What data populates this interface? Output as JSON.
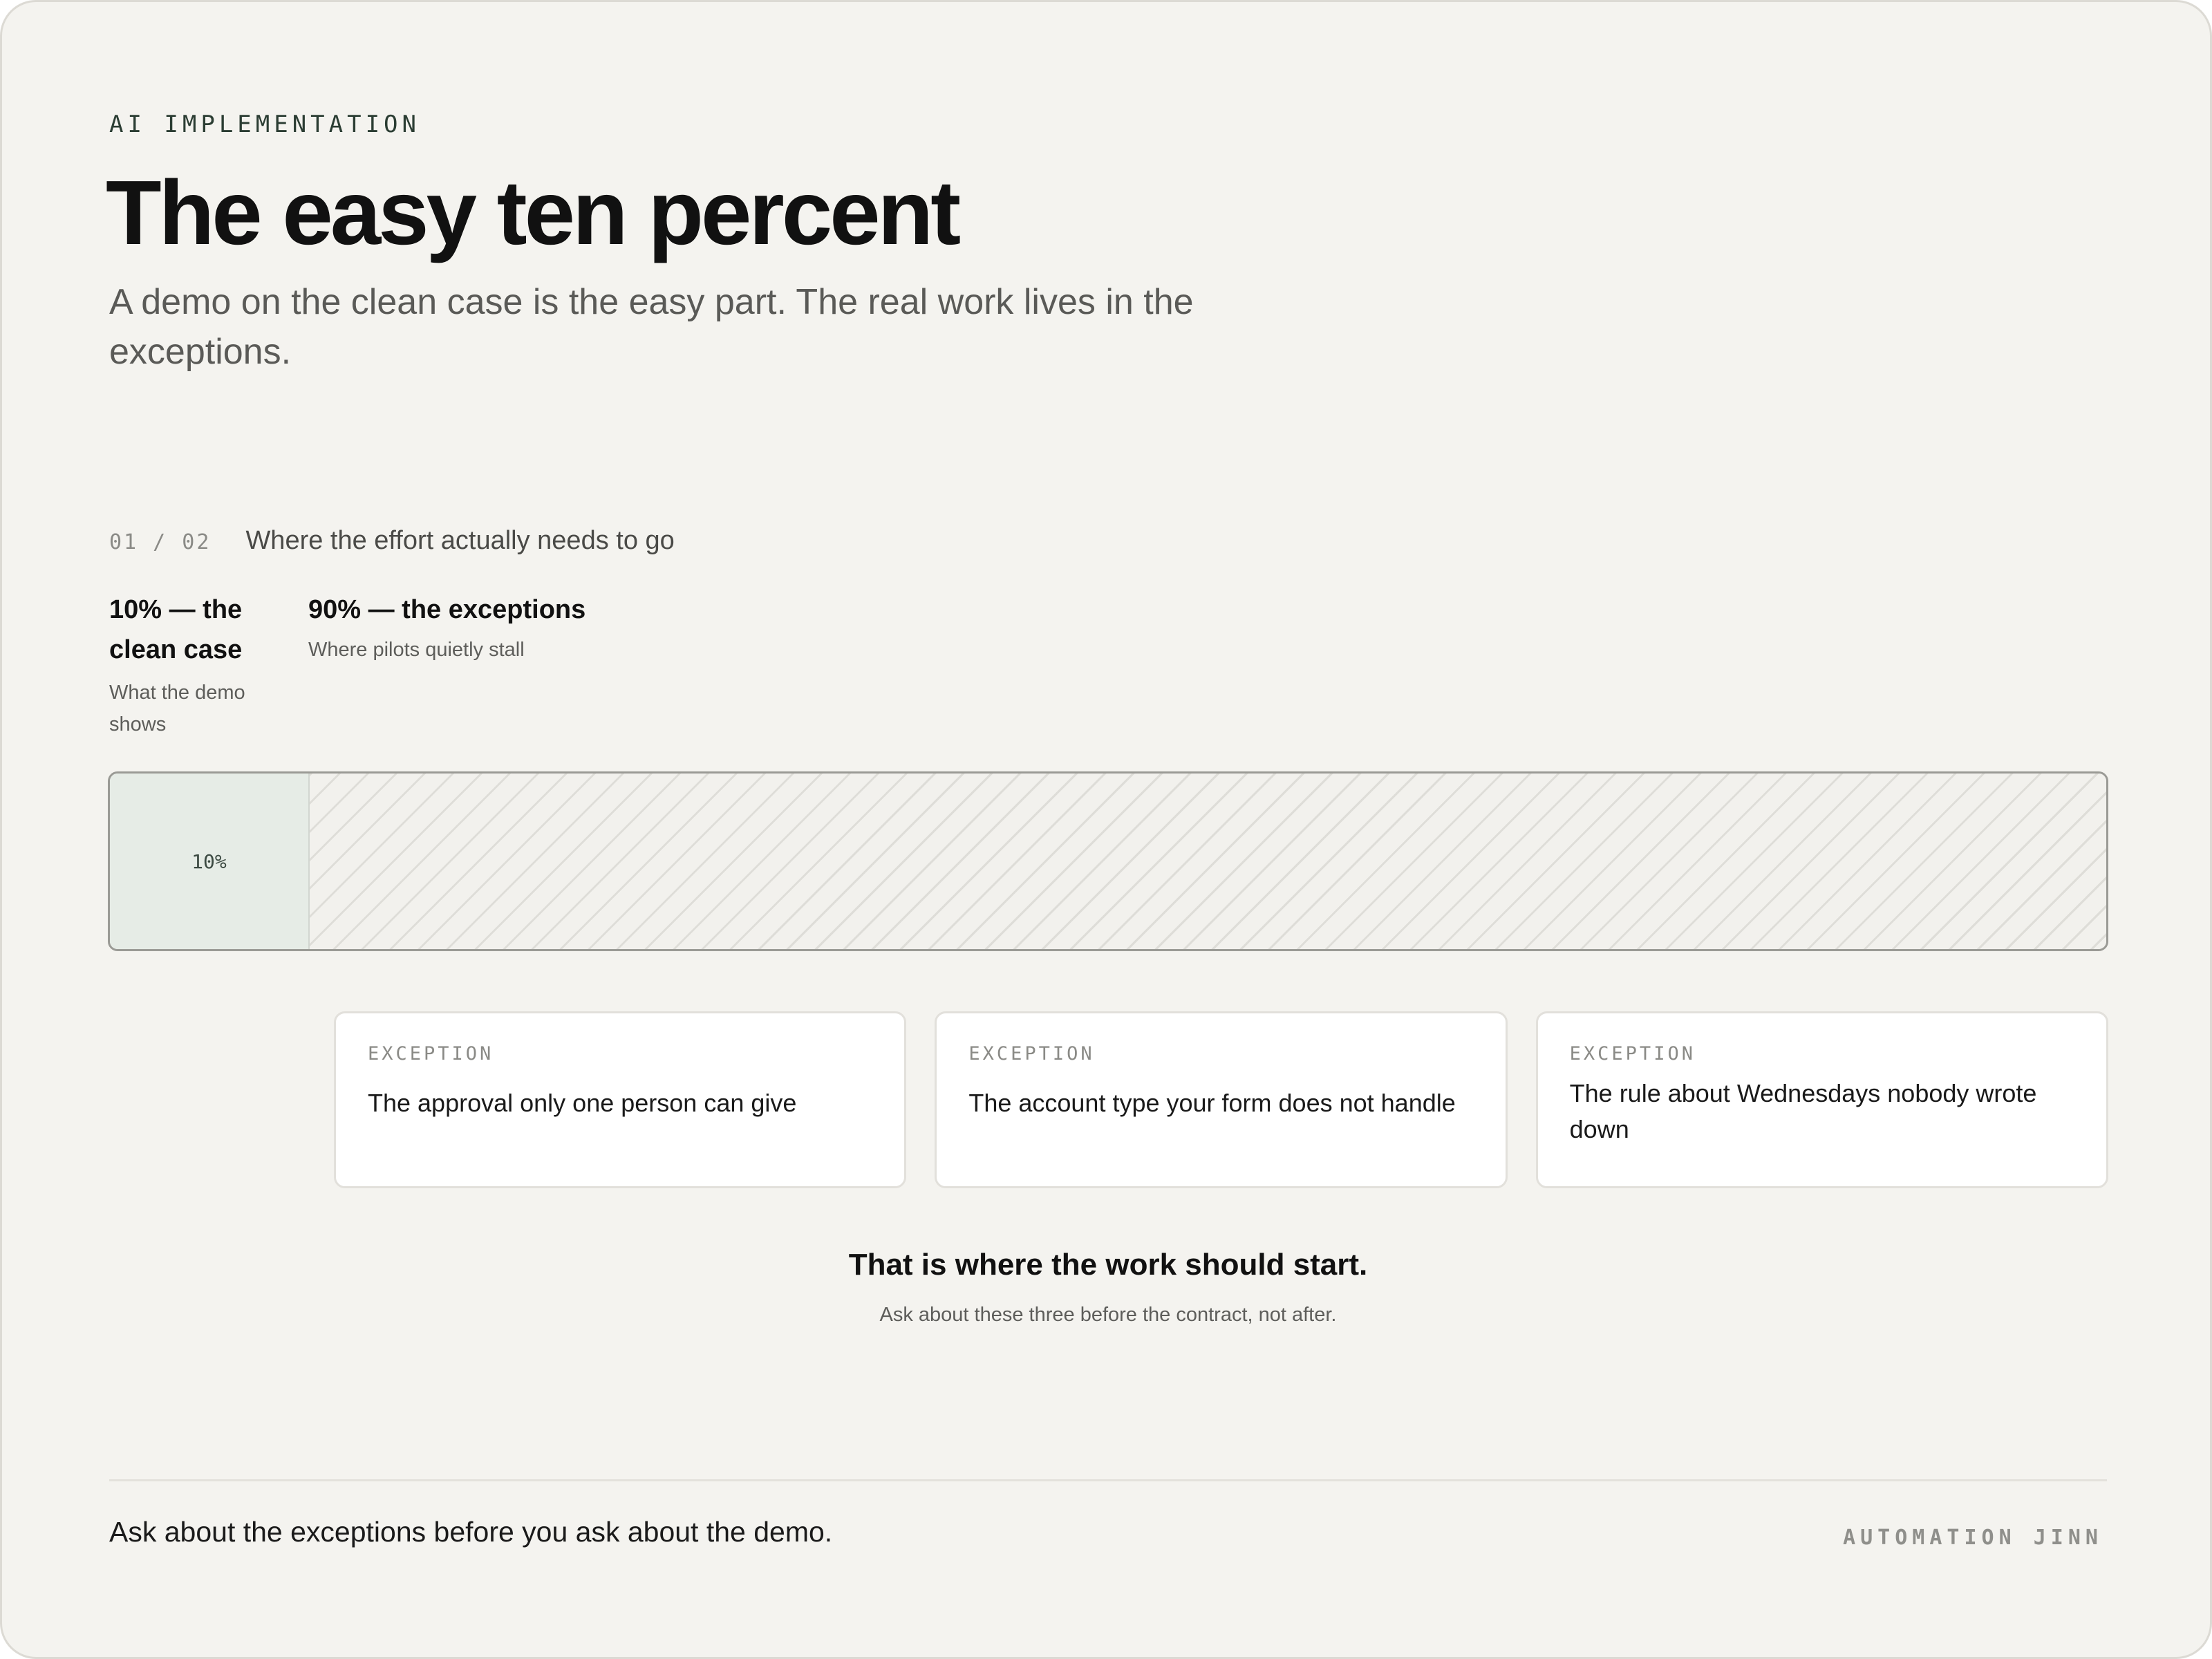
{
  "header": {
    "eyebrow": "AI IMPLEMENTATION",
    "title": "The easy ten percent",
    "subtitle": "A demo on the clean case is the easy part. The real work lives in the exceptions."
  },
  "section": {
    "step": "01 / 02",
    "title": "Where the effort actually needs to go"
  },
  "segments": [
    {
      "title": "10% — the clean case",
      "subtitle": "What the demo shows",
      "share_percent": 10
    },
    {
      "title": "90% — the exceptions",
      "subtitle": "Where pilots quietly stall",
      "share_percent": 90
    }
  ],
  "bar": {
    "clean_label": "10%"
  },
  "exceptions": [
    {
      "kicker": "EXCEPTION",
      "text": "The approval only one person can give"
    },
    {
      "kicker": "EXCEPTION",
      "text": "The account type your form does not handle"
    },
    {
      "kicker": "EXCEPTION",
      "text": "The rule about Wednesdays nobody wrote down"
    }
  ],
  "takeaway": {
    "headline": "That is where the work should start.",
    "subline": "Ask about these three before the contract, not after."
  },
  "footer": {
    "note": "Ask about the exceptions before you ask about the demo.",
    "brand": "AUTOMATION JINN"
  },
  "colors": {
    "background": "#f4f3ef",
    "clean_fill": "#e6ece6",
    "accent_text": "#2b3d33",
    "card": "#ffffff"
  }
}
